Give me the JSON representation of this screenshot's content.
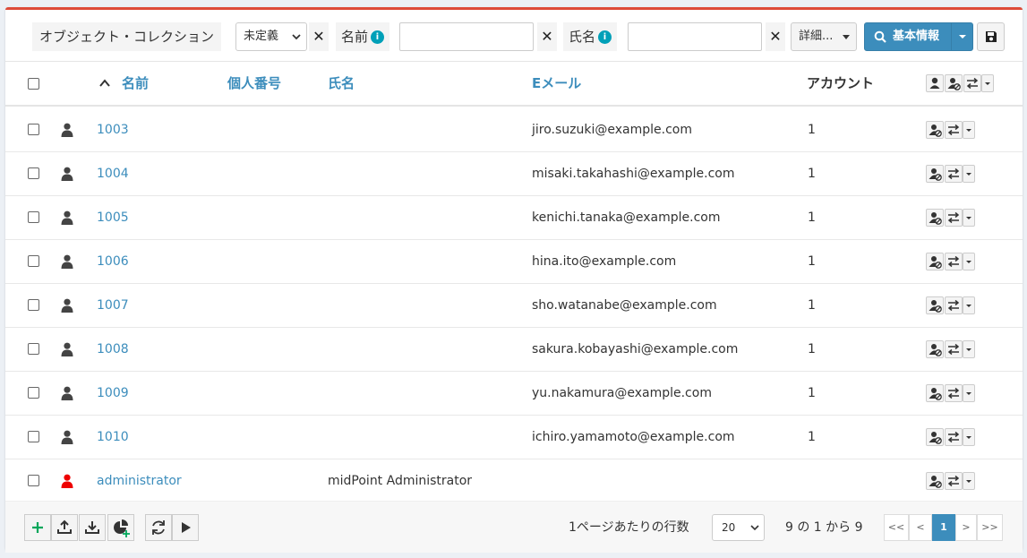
{
  "search": {
    "object_collection_label": "オブジェクト・コレクション",
    "collection_select_value": "未定義",
    "name_label": "名前",
    "name_value": "",
    "fullname_label": "氏名",
    "fullname_value": "",
    "more_label": "詳細...",
    "basic_button_label": "基本情報",
    "info_glyph": "i",
    "clear_glyph": "✕"
  },
  "table": {
    "headers": {
      "name": "名前",
      "personal_number": "個人番号",
      "fullname": "氏名",
      "email": "Eメール",
      "accounts": "アカウント"
    },
    "rows": [
      {
        "name": "1003",
        "personal_number": "",
        "fullname": "",
        "email": "jiro.suzuki@example.com",
        "accounts": "1",
        "icon_color": "#444444"
      },
      {
        "name": "1004",
        "personal_number": "",
        "fullname": "",
        "email": "misaki.takahashi@example.com",
        "accounts": "1",
        "icon_color": "#444444"
      },
      {
        "name": "1005",
        "personal_number": "",
        "fullname": "",
        "email": "kenichi.tanaka@example.com",
        "accounts": "1",
        "icon_color": "#444444"
      },
      {
        "name": "1006",
        "personal_number": "",
        "fullname": "",
        "email": "hina.ito@example.com",
        "accounts": "1",
        "icon_color": "#444444"
      },
      {
        "name": "1007",
        "personal_number": "",
        "fullname": "",
        "email": "sho.watanabe@example.com",
        "accounts": "1",
        "icon_color": "#444444"
      },
      {
        "name": "1008",
        "personal_number": "",
        "fullname": "",
        "email": "sakura.kobayashi@example.com",
        "accounts": "1",
        "icon_color": "#444444"
      },
      {
        "name": "1009",
        "personal_number": "",
        "fullname": "",
        "email": "yu.nakamura@example.com",
        "accounts": "1",
        "icon_color": "#444444"
      },
      {
        "name": "1010",
        "personal_number": "",
        "fullname": "",
        "email": "ichiro.yamamoto@example.com",
        "accounts": "1",
        "icon_color": "#444444"
      },
      {
        "name": "administrator",
        "personal_number": "",
        "fullname": "midPoint Administrator",
        "email": "",
        "accounts": "",
        "icon_color": "#ee0000"
      }
    ]
  },
  "footer": {
    "rows_per_page_label": "1ページあたりの行数",
    "rows_per_page_value": "20",
    "range_text": "9 の 1 から 9",
    "pages": [
      "<<",
      "<",
      "1",
      ">",
      ">>"
    ],
    "active_page": "1"
  },
  "colors": {
    "accent": "#3c8dbc",
    "top_border": "#dd4b39",
    "add_icon": "#00a65a"
  }
}
